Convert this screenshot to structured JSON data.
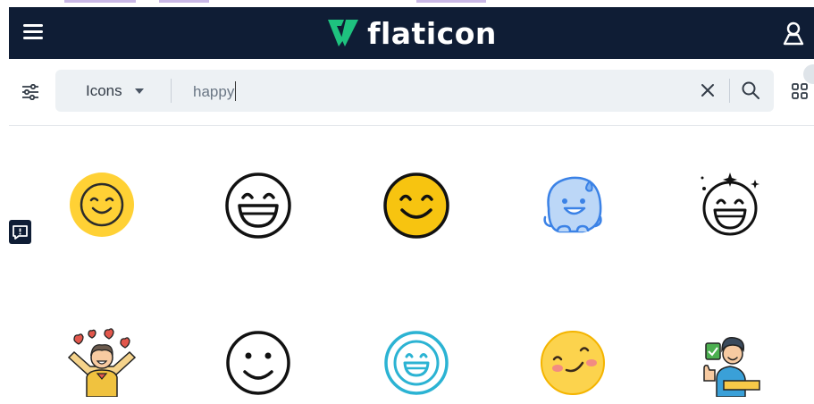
{
  "header": {
    "brand": "flaticon",
    "colors": {
      "bg": "#0f1d35",
      "accent": "#1ec27f"
    }
  },
  "search": {
    "type_label": "Icons",
    "query": "happy"
  },
  "toolbar": {
    "collections_count": "0"
  },
  "results": [
    {
      "name": "smile-closed-eyes-yellow-icon"
    },
    {
      "name": "laughing-outline-icon"
    },
    {
      "name": "smiling-yellow-outline-icon"
    },
    {
      "name": "blue-blob-sweat-icon"
    },
    {
      "name": "laughing-sparkle-icon"
    },
    {
      "name": "person-hearts-icon"
    },
    {
      "name": "simple-smile-outline-icon"
    },
    {
      "name": "teal-grin-icon"
    },
    {
      "name": "blush-smile-icon"
    },
    {
      "name": "man-thumbs-up-icon"
    }
  ]
}
